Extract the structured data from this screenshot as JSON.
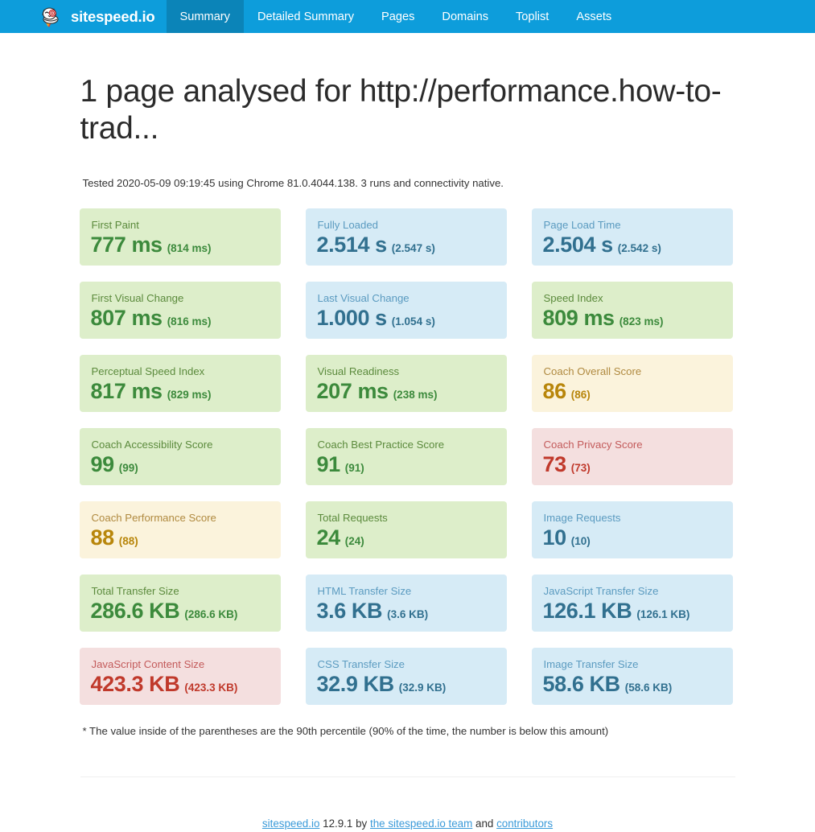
{
  "navbar": {
    "brand": "sitespeed.io",
    "logo_icon": "sitespeed-cat-logo-icon",
    "items": [
      {
        "label": "Summary",
        "active": true
      },
      {
        "label": "Detailed Summary",
        "active": false
      },
      {
        "label": "Pages",
        "active": false
      },
      {
        "label": "Domains",
        "active": false
      },
      {
        "label": "Toplist",
        "active": false
      },
      {
        "label": "Assets",
        "active": false
      }
    ]
  },
  "main": {
    "title": "1 page analysed for http://performance.how-to-trad...",
    "tested_line": "Tested 2020-05-09 09:19:45 using Chrome 81.0.4044.138. 3 runs and connectivity native.",
    "footnote": "* The value inside of the parentheses are the 90th percentile (90% of the time, the number is below this amount)",
    "cards": [
      {
        "label": "First Paint",
        "value": "777 ms",
        "percentile": "(814 ms)",
        "color": "green"
      },
      {
        "label": "Fully Loaded",
        "value": "2.514 s",
        "percentile": "(2.547 s)",
        "color": "blue"
      },
      {
        "label": "Page Load Time",
        "value": "2.504 s",
        "percentile": "(2.542 s)",
        "color": "blue"
      },
      {
        "label": "First Visual Change",
        "value": "807 ms",
        "percentile": "(816 ms)",
        "color": "green"
      },
      {
        "label": "Last Visual Change",
        "value": "1.000 s",
        "percentile": "(1.054 s)",
        "color": "blue"
      },
      {
        "label": "Speed Index",
        "value": "809 ms",
        "percentile": "(823 ms)",
        "color": "green"
      },
      {
        "label": "Perceptual Speed Index",
        "value": "817 ms",
        "percentile": "(829 ms)",
        "color": "green"
      },
      {
        "label": "Visual Readiness",
        "value": "207 ms",
        "percentile": "(238 ms)",
        "color": "green"
      },
      {
        "label": "Coach Overall Score",
        "value": "86",
        "percentile": "(86)",
        "color": "yellow"
      },
      {
        "label": "Coach Accessibility Score",
        "value": "99",
        "percentile": "(99)",
        "color": "green"
      },
      {
        "label": "Coach Best Practice Score",
        "value": "91",
        "percentile": "(91)",
        "color": "green"
      },
      {
        "label": "Coach Privacy Score",
        "value": "73",
        "percentile": "(73)",
        "color": "red"
      },
      {
        "label": "Coach Performance Score",
        "value": "88",
        "percentile": "(88)",
        "color": "yellow"
      },
      {
        "label": "Total Requests",
        "value": "24",
        "percentile": "(24)",
        "color": "green"
      },
      {
        "label": "Image Requests",
        "value": "10",
        "percentile": "(10)",
        "color": "blue"
      },
      {
        "label": "Total Transfer Size",
        "value": "286.6 KB",
        "percentile": "(286.6 KB)",
        "color": "green"
      },
      {
        "label": "HTML Transfer Size",
        "value": "3.6 KB",
        "percentile": "(3.6 KB)",
        "color": "blue"
      },
      {
        "label": "JavaScript Transfer Size",
        "value": "126.1 KB",
        "percentile": "(126.1 KB)",
        "color": "blue"
      },
      {
        "label": "JavaScript Content Size",
        "value": "423.3 KB",
        "percentile": "(423.3 KB)",
        "color": "red"
      },
      {
        "label": "CSS Transfer Size",
        "value": "32.9 KB",
        "percentile": "(32.9 KB)",
        "color": "blue"
      },
      {
        "label": "Image Transfer Size",
        "value": "58.6 KB",
        "percentile": "(58.6 KB)",
        "color": "blue"
      }
    ]
  },
  "footer": {
    "link_sitespeed": "sitespeed.io",
    "version": "12.9.1",
    "by": "by",
    "link_team": "the sitespeed.io team",
    "and": "and",
    "link_contributors": "contributors"
  },
  "colors": {
    "navbar_bg": "#0d9ddb",
    "navbar_active_bg": "#0b84b8",
    "green_bg": "#ddeeca",
    "green_text": "#3c8a3c",
    "blue_bg": "#d6ebf6",
    "blue_text": "#31708f",
    "yellow_bg": "#fbf3dc",
    "yellow_text": "#b8860b",
    "red_bg": "#f4dfdf",
    "red_text": "#c0392b",
    "link": "#3a9ad9"
  }
}
